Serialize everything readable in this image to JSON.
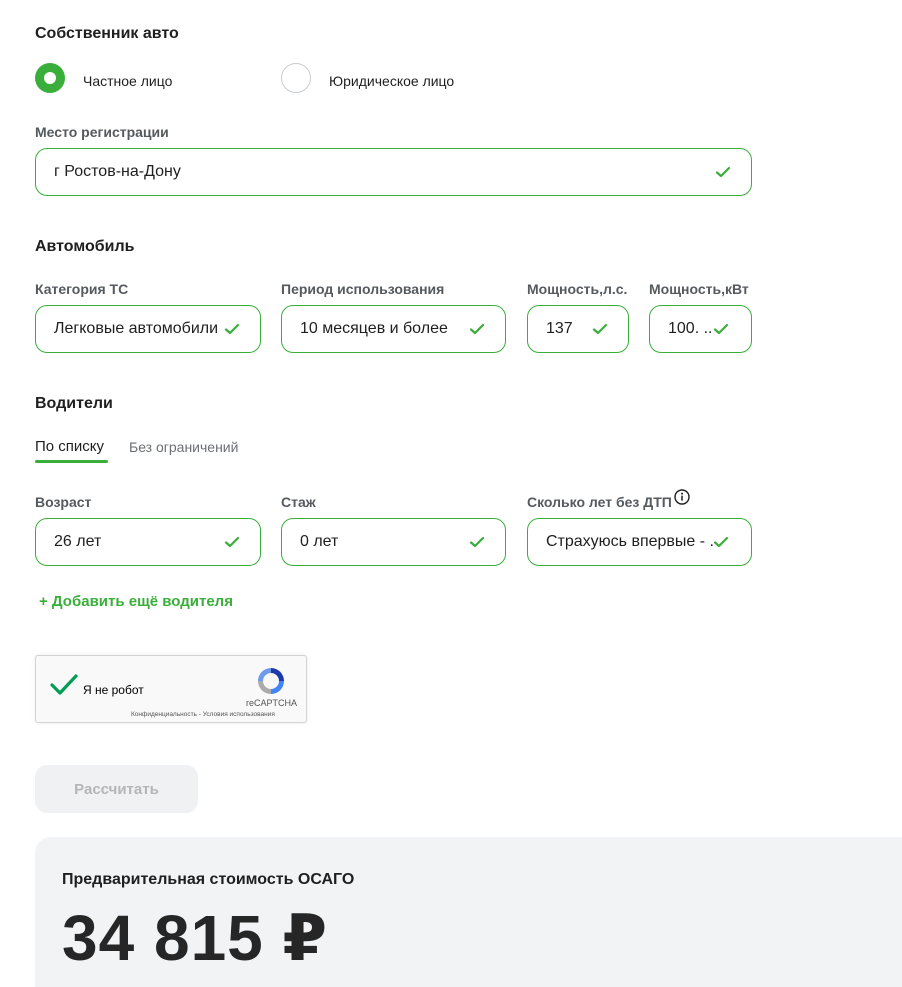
{
  "owner": {
    "title": "Собственник авто",
    "options": [
      {
        "label": "Частное лицо",
        "selected": true
      },
      {
        "label": "Юридическое лицо",
        "selected": false
      }
    ],
    "registration_label": "Место регистрации",
    "registration_value": "г Ростов-на-Дону"
  },
  "car": {
    "title": "Автомобиль",
    "category_label": "Категория ТС",
    "category_value": "Легковые автомобили",
    "period_label": "Период использования",
    "period_value": "10 месяцев и более",
    "power_hp_label": "Мощность,л.с.",
    "power_hp_value": "137",
    "power_kw_label": "Мощность,кВт",
    "power_kw_value": "100. ..."
  },
  "drivers": {
    "title": "Водители",
    "tabs": [
      {
        "label": "По списку",
        "active": true
      },
      {
        "label": "Без ограничений",
        "active": false
      }
    ],
    "age_label": "Возраст",
    "age_value": "26 лет",
    "experience_label": "Стаж",
    "experience_value": "0 лет",
    "no_accident_label": "Сколько лет без ДТП",
    "no_accident_value": "Страхуюсь впервые - ...",
    "add_driver": "+ Добавить ещё водителя"
  },
  "captcha": {
    "label": "Я не робот",
    "brand": "reCAPTCHA",
    "links": "Конфиденциальность - Условия использования"
  },
  "calculate_button": "Рассчитать",
  "result": {
    "title": "Предварительная стоимость ОСАГО",
    "amount": "34 815 ₽"
  },
  "colors": {
    "accent": "#3aae3a",
    "disabled_button_bg": "#f0f1f2",
    "result_bg": "#f2f3f5"
  },
  "icons": [
    "check-icon",
    "info-icon",
    "recaptcha-logo-icon",
    "captcha-checkmark-icon"
  ]
}
